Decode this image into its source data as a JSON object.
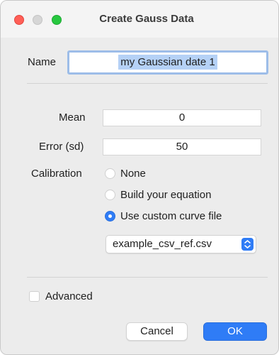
{
  "window": {
    "title": "Create Gauss Data"
  },
  "form": {
    "name_label": "Name",
    "name_value": "my Gaussian date 1",
    "mean_label": "Mean",
    "mean_value": "0",
    "error_label": "Error (sd)",
    "error_value": "50",
    "calibration_label": "Calibration",
    "calibration_options": [
      {
        "label": "None",
        "selected": false
      },
      {
        "label": "Build your equation",
        "selected": false
      },
      {
        "label": "Use custom curve file",
        "selected": true
      }
    ],
    "curve_file": "example_csv_ref.csv",
    "advanced_label": "Advanced",
    "advanced_checked": false
  },
  "buttons": {
    "cancel": "Cancel",
    "ok": "OK"
  },
  "colors": {
    "accent": "#2f7cf6",
    "close": "#ff5f57",
    "zoom": "#28c840"
  }
}
